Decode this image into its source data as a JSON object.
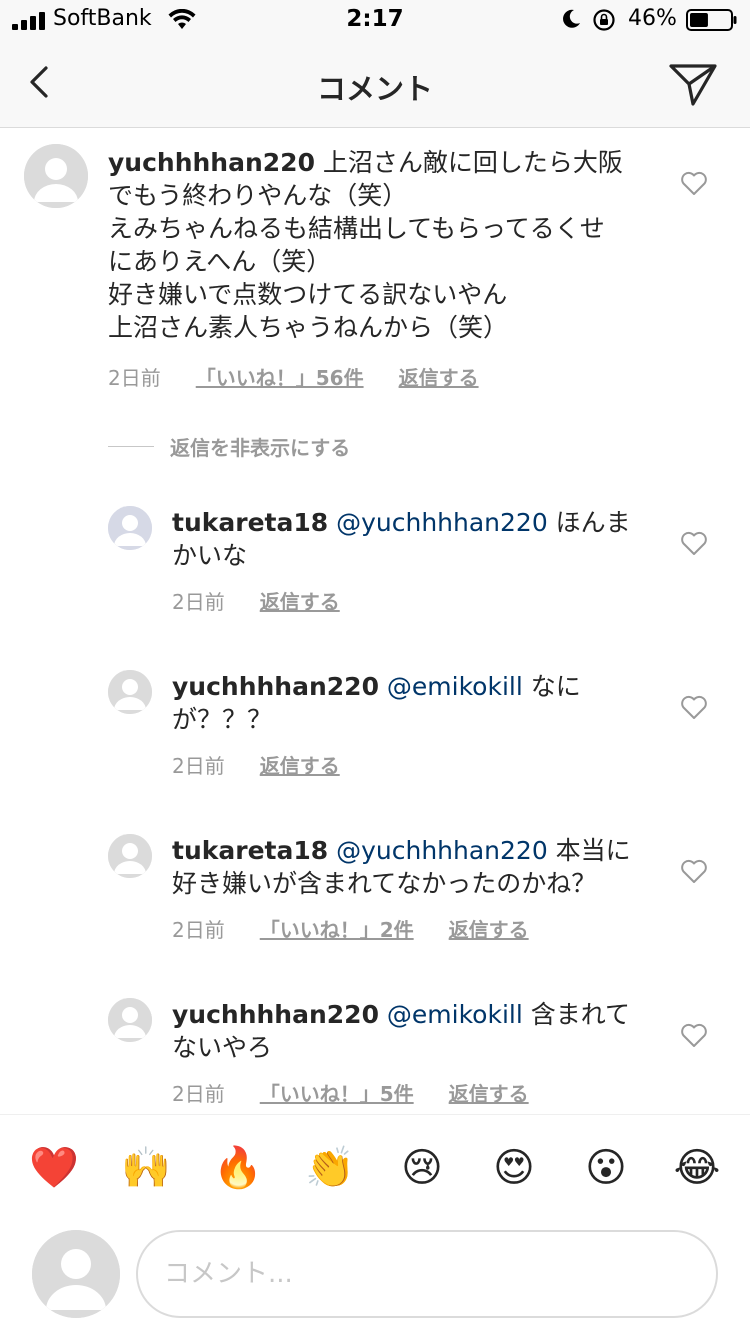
{
  "status_bar": {
    "carrier": "SoftBank",
    "time": "2:17",
    "battery": "46%",
    "battery_level": 0.46
  },
  "header": {
    "title": "コメント",
    "back_icon": "chevron-left-icon",
    "send_icon": "paper-plane-icon"
  },
  "main_comment": {
    "username": "yuchhhhan220",
    "text_first": " 上沼さん敵に回したら大阪",
    "text_lines": [
      "でもう終わりやんな（笑）",
      "えみちゃんねるも結構出してもらってるくせ",
      "にありえへん（笑）",
      "好き嫌いで点数つけてる訳ないやん",
      "上沼さん素人ちゃうねんから（笑）"
    ],
    "time": "2日前",
    "likes": "「いいね！」56件",
    "reply": "返信する"
  },
  "hide_replies": "返信を非表示にする",
  "replies": [
    {
      "username": "tukareta18",
      "mention": " @yuchhhhan220",
      "text": " ほんま",
      "text_line2": "かいな",
      "time": "2日前",
      "likes": "",
      "reply": "返信する"
    },
    {
      "username": "yuchhhhan220",
      "mention": " @emikokill",
      "text": " なに",
      "text_line2": "が？？？",
      "time": "2日前",
      "likes": "",
      "reply": "返信する"
    },
    {
      "username": "tukareta18",
      "mention": " @yuchhhhan220",
      "text": " 本当に",
      "text_line2": "好き嫌いが含まれてなかったのかね？",
      "time": "2日前",
      "likes": "「いいね！」2件",
      "reply": "返信する"
    },
    {
      "username": "yuchhhhan220",
      "mention": " @emikokill",
      "text": " 含まれて",
      "text_line2": "ないやろ",
      "time": "2日前",
      "likes": "「いいね！」5件",
      "reply": "返信する"
    }
  ],
  "emoji_bar": [
    {
      "glyph": "❤️",
      "name": "heart"
    },
    {
      "glyph": "🙌",
      "name": "raised-hands"
    },
    {
      "glyph": "🔥",
      "name": "fire"
    },
    {
      "glyph": "👏",
      "name": "clapping-hands"
    },
    {
      "glyph": "😢",
      "name": "crying-face"
    },
    {
      "glyph": "😍",
      "name": "heart-eyes"
    },
    {
      "glyph": "😮",
      "name": "surprised-face"
    },
    {
      "glyph": "😂",
      "name": "tears-of-joy"
    }
  ],
  "composer": {
    "placeholder": "コメント..."
  },
  "colors": {
    "mention": "#003569",
    "meta": "#999999",
    "text": "#262626",
    "header_bg": "#f8f8f8"
  }
}
